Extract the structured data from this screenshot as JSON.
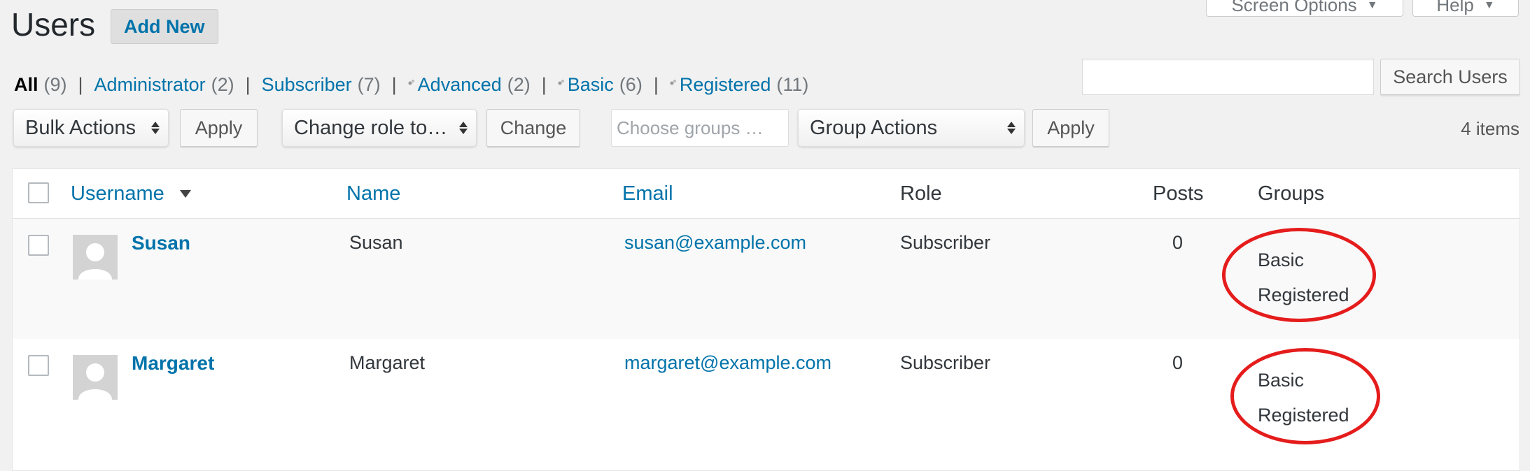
{
  "screen_tabs": {
    "screen_options": "Screen Options",
    "help": "Help"
  },
  "header": {
    "title": "Users",
    "add_new": "Add New"
  },
  "views": [
    {
      "label": "All",
      "count": "(9)",
      "current": true
    },
    {
      "label": "Administrator",
      "count": "(2)"
    },
    {
      "label": "Subscriber",
      "count": "(7)"
    },
    {
      "label": "Advanced",
      "count": "(2)",
      "group": true
    },
    {
      "label": "Basic",
      "count": "(6)",
      "group": true
    },
    {
      "label": "Registered",
      "count": "(11)",
      "group": true
    }
  ],
  "search": {
    "value": "",
    "button": "Search Users"
  },
  "toolbar": {
    "bulk_actions": "Bulk Actions",
    "apply": "Apply",
    "change_role": "Change role to…",
    "change": "Change",
    "groups_placeholder": "Choose groups …",
    "group_actions": "Group Actions",
    "apply2": "Apply",
    "items_count": "4 items"
  },
  "table": {
    "columns": {
      "username": "Username",
      "name": "Name",
      "email": "Email",
      "role": "Role",
      "posts": "Posts",
      "groups": "Groups"
    },
    "rows": [
      {
        "username": "Susan",
        "name": "Susan",
        "email": "susan@example.com",
        "role": "Subscriber",
        "posts": "0",
        "groups": [
          "Basic",
          "Registered"
        ]
      },
      {
        "username": "Margaret",
        "name": "Margaret",
        "email": "margaret@example.com",
        "role": "Subscriber",
        "posts": "0",
        "groups": [
          "Basic",
          "Registered"
        ]
      }
    ]
  },
  "colors": {
    "link": "#0073aa",
    "highlight_ellipse": "#e51c1c",
    "background": "#f1f1f1"
  }
}
